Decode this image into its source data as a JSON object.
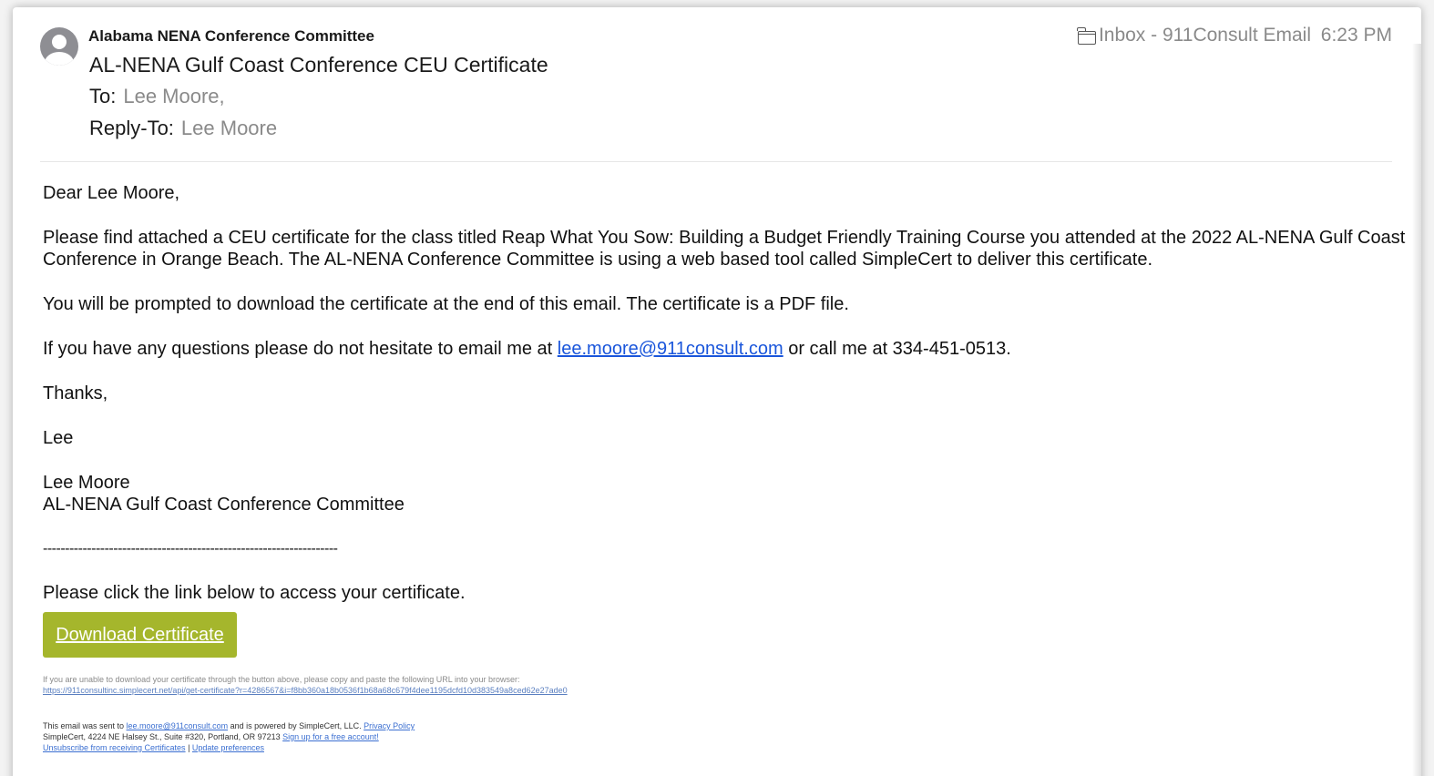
{
  "header": {
    "sender": "Alabama NENA Conference Committee",
    "subject": "AL-NENA Gulf Coast Conference CEU Certificate",
    "to_label": "To:",
    "to_value": "Lee Moore,",
    "reply_to_label": "Reply-To:",
    "reply_to_value": "Lee Moore",
    "mailbox": "Inbox - 911Consult Email",
    "time": "6:23 PM",
    "mailbox_icon": "folder-icon",
    "avatar_icon": "person-icon"
  },
  "body": {
    "greeting": "Dear Lee Moore,",
    "para1": "Please find attached a CEU certificate for the class titled Reap What You Sow: Building a Budget Friendly Training Course you attended at the 2022 AL-NENA Gulf Coast Conference in Orange Beach. The AL-NENA Conference Committee is using a web based tool called SimpleCert to deliver this certificate.",
    "para2": "You will be prompted to download the certificate at the end of this email. The certificate is a PDF file.",
    "para3_before": "If you have any questions please do not hesitate to email me at ",
    "para3_email": "lee.moore@911consult.com",
    "para3_after": " or call me at 334-451-0513.",
    "thanks": "Thanks,",
    "signoff": "Lee",
    "sig_name": "Lee Moore",
    "sig_org": "AL-NENA Gulf Coast Conference Committee",
    "separator": "-------------------------------------------------------------------",
    "click_prompt": "Please click the link below to access your certificate."
  },
  "download": {
    "label": "Download Certificate",
    "color": "#a5b62c"
  },
  "fallback": {
    "text": "If you are unable to download your certificate through the button above, please copy and paste the following URL into your browser:",
    "url": "https://911consultinc.simplecert.net/api/get-certificate?r=4286567&i=f8bb360a18b0536f1b68a68c679f4dee1195dcfd10d383549a8ced62e27ade0"
  },
  "footer": {
    "sent_to_before": "This email was sent to ",
    "sent_to_email": "lee.moore@911consult.com",
    "sent_to_after": "  and is powered by SimpleCert, LLC.  ",
    "privacy_link": "Privacy Policy",
    "address": "SimpleCert, 4224 NE Halsey St., Suite #320, Portland, OR 97213 ",
    "signup_link": "Sign up for a free account!",
    "unsubscribe_link": "Unsubscribe from receiving Certificates",
    "pipe": " | ",
    "preferences_link": "Update preferences"
  },
  "colors": {
    "link": "#1a56db",
    "muted": "#8a8a8a"
  }
}
